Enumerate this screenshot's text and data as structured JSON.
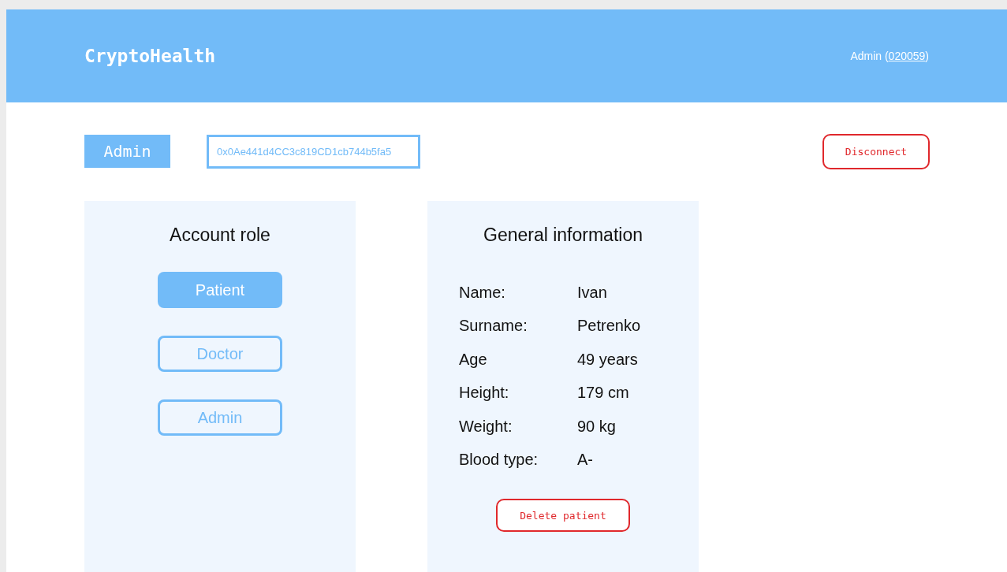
{
  "header": {
    "logo": "CryptoHealth",
    "user_prefix": "Admin (",
    "user_id": "020059",
    "user_suffix": ")"
  },
  "account_bar": {
    "role_badge": "Admin",
    "address": "0x0Ae441d4CC3c819CD1cb744b5fa5",
    "disconnect": "Disconnect"
  },
  "role_panel": {
    "title": "Account role",
    "roles": [
      {
        "label": "Patient",
        "selected": true
      },
      {
        "label": "Doctor",
        "selected": false
      },
      {
        "label": "Admin",
        "selected": false
      }
    ]
  },
  "info_panel": {
    "title": "General information",
    "rows": [
      {
        "label": "Name:",
        "value": "Ivan"
      },
      {
        "label": "Surname:",
        "value": "Petrenko"
      },
      {
        "label": "Age",
        "value": "49 years"
      },
      {
        "label": "Height:",
        "value": "179 cm"
      },
      {
        "label": "Weight:",
        "value": "90 kg"
      },
      {
        "label": "Blood type:",
        "value": "A-"
      }
    ],
    "delete_button": "Delete patient"
  }
}
